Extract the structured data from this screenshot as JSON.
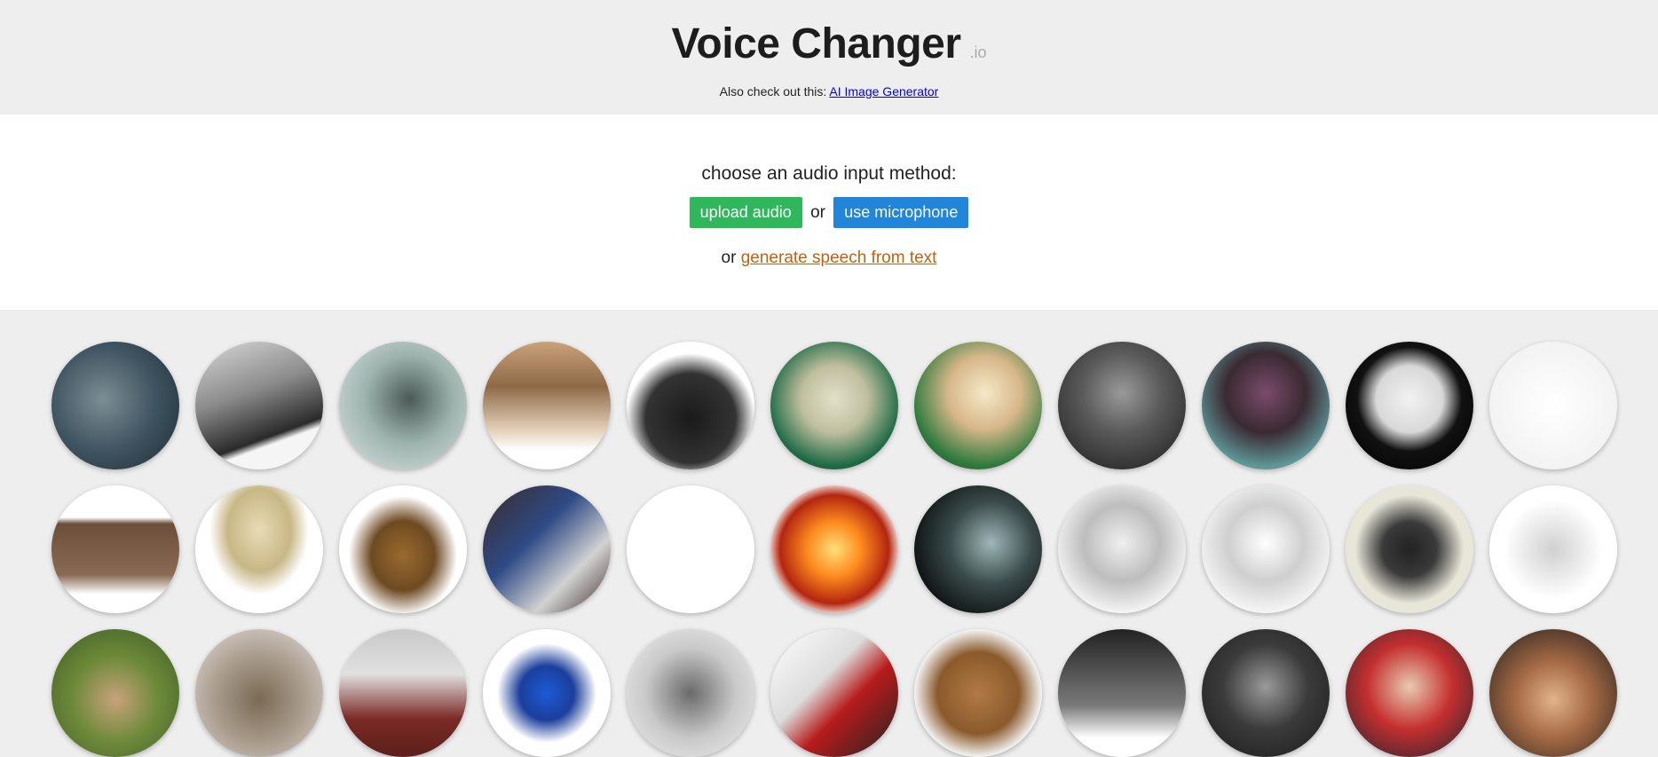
{
  "header": {
    "title": "Voice Changer",
    "title_suffix": ".io",
    "promo_text": "Also check out this: ",
    "promo_link": "AI Image Generator"
  },
  "input": {
    "prompt": "choose an audio input method:",
    "upload_label": "upload audio",
    "or_1": "or",
    "mic_label": "use microphone",
    "or_2": "or",
    "tts_label": "generate speech from text"
  },
  "colors": {
    "upload_button": "#2fb85b",
    "mic_button": "#2185d9",
    "tts_link": "#c26112",
    "page_bg": "#eeeeee"
  },
  "voices": [
    {
      "icon": "monster-icon",
      "bg": "radial-gradient(circle at 40% 45%, #7d8d94 0%, #3f5561 50%, #1c2a33 100%)"
    },
    {
      "icon": "megaphone-icon",
      "bg": "linear-gradient(160deg, #d9d9d9 0%, #8b8b8b 40%, #2a2a2a 70%, #f5f5f5 75%)"
    },
    {
      "icon": "ghost-icon",
      "bg": "radial-gradient(circle at 55% 45%, #4b5a57 0%, #9eb3ae 45%, #dde6e3 100%)"
    },
    {
      "icon": "church-icon",
      "bg": "linear-gradient(180deg, #c9a27a 0%, #8e6a47 35%, #e6d3bc 70%, #ffffff 85%)"
    },
    {
      "icon": "telephone-icon",
      "bg": "radial-gradient(circle at 50% 60%, #1a1a1a 0%, #333 45%, #ffffff 65%)"
    },
    {
      "icon": "alien-icon",
      "bg": "radial-gradient(circle at 50% 45%, #e3e0c9 0%, #bfbf9f 35%, #1f6b46 70%, #0f2f22 100%)"
    },
    {
      "icon": "melting-clock-icon",
      "bg": "radial-gradient(circle at 55% 40%, #f5e9c7 0%, #d7b78a 35%, #2f7a3d 70%, #1a3d20 100%)"
    },
    {
      "icon": "grey-alien-icon",
      "bg": "radial-gradient(circle at 50% 40%, #9a9a9a 0%, #5a5a5a 40%, #1a1a1a 100%)"
    },
    {
      "icon": "robot-bug-icon",
      "bg": "radial-gradient(circle at 50% 40%, #7a4b6a 0%, #3a2a33 40%, #5f9a9a 75%, #22343a 100%)"
    },
    {
      "icon": "mask-icon",
      "bg": "radial-gradient(circle at 50% 45%, #f2f2f2 0%, #d8d8d8 35%, #111 55%, #000 100%)"
    },
    {
      "icon": "reverse-clock-icon",
      "bg": "radial-gradient(circle at 50% 50%, #ffffff 0%, #f2f2f2 75%, #bdbdbd 92%, #e0e0e0 100%)"
    },
    {
      "icon": "radio-icon",
      "bg": "linear-gradient(180deg, #ffffff 0%, #ffffff 25%, #6b4f3a 30%, #8a6a55 70%, #ffffff 85%)"
    },
    {
      "icon": "cymbal-icon",
      "bg": "radial-gradient(ellipse at 50% 35%, #e8dcb5 0%, #c8b786 35%, #ffffff 55%)"
    },
    {
      "icon": "dalek-icon",
      "bg": "radial-gradient(ellipse at 50% 55%, #9a6a2f 0%, #6e4a22 35%, #ffffff 60%)"
    },
    {
      "icon": "pedal-icon",
      "bg": "linear-gradient(135deg, #3b2b28 0%, #2f4a86 40%, #d2d2d2 70%, #3b2b28 100%)"
    },
    {
      "icon": "sine-wave-icon",
      "bg": "linear-gradient(180deg, #ffffff 0%, #ffffff 100%)"
    },
    {
      "icon": "fire-demon-icon",
      "bg": "radial-gradient(circle at 50% 50%, #ffe07a 0%, #ff8a1e 30%, #b3260f 60%, #ffffff 75%)"
    },
    {
      "icon": "cave-icon",
      "bg": "radial-gradient(circle at 60% 45%, #9fb7b7 0%, #3a4a4a 40%, #101414 75%)"
    },
    {
      "icon": "robot-eye-icon",
      "bg": "radial-gradient(circle at 50% 45%, #f0f0f0 0%, #bdbdbd 40%, #f7f7f7 75%)"
    },
    {
      "icon": "robot-walker-icon",
      "bg": "radial-gradient(circle at 50% 45%, #ffffff 0%, #cfcfcf 40%, #f7f7f7 75%)"
    },
    {
      "icon": "toy-robot-icon",
      "bg": "radial-gradient(circle at 50% 50%, #222 0%, #3a3a3a 30%, #e7e6d8 60%)"
    },
    {
      "icon": "lego-robot-icon",
      "bg": "radial-gradient(circle at 50% 50%, #d0d0d0 0%, #ffffff 55%)"
    },
    {
      "icon": "snail-icon",
      "bg": "radial-gradient(circle at 50% 55%, #c9a27a 0%, #6d8a3a 45%, #3d5a24 100%)"
    },
    {
      "icon": "tortoise-icon",
      "bg": "radial-gradient(circle at 50% 55%, #7a6a55 0%, #a79a8a 45%, #e6dede 100%)"
    },
    {
      "icon": "runner-icon",
      "bg": "linear-gradient(180deg, #c9c9c9 0%, #e0e0e0 35%, #7b2a25 70%, #5c1f1b 100%)"
    },
    {
      "icon": "sonic-icon",
      "bg": "radial-gradient(circle at 50% 50%, #1e5ad6 0%, #1b3f9c 30%, #ffffff 55%)"
    },
    {
      "icon": "walkie-talkie-icon",
      "bg": "radial-gradient(circle at 50% 50%, #6a6a6a 0%, #c9c9c9 50%, #f0f0f0 100%)"
    },
    {
      "icon": "cards-icon",
      "bg": "linear-gradient(135deg, #ffffff 0%, #dcdcdc 40%, #b71c1c 60%, #222 100%)"
    },
    {
      "icon": "speaker-icon",
      "bg": "radial-gradient(circle at 50% 50%, #b07a45 0%, #8b5a2b 45%, #f1f1f1 70%)"
    },
    {
      "icon": "phonograph-icon",
      "bg": "linear-gradient(180deg, #222 0%, #7a7a7a 60%, #ffffff 85%)"
    },
    {
      "icon": "dark-knight-icon",
      "bg": "radial-gradient(circle at 50% 45%, #9a9a9a 0%, #3b3b3b 45%, #1a1a1a 100%)"
    },
    {
      "icon": "soldier-icon",
      "bg": "radial-gradient(circle at 50% 45%, #e8cbb0 0%, #c42f2f 45%, #1c2430 100%)"
    },
    {
      "icon": "meme-face-icon",
      "bg": "radial-gradient(circle at 50% 55%, #e2b38a 0%, #a56a45 40%, #1b1b1b 100%)"
    }
  ]
}
